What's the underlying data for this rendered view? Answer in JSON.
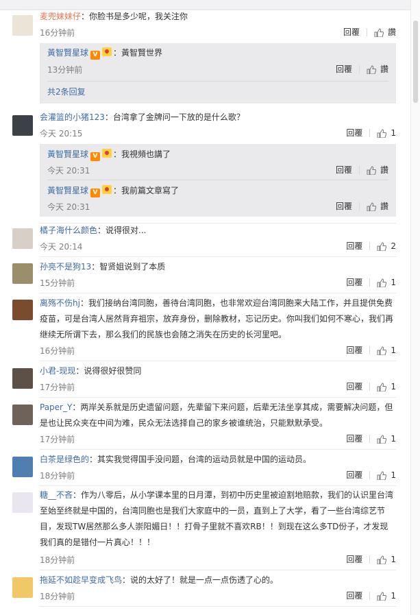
{
  "reply_label": "回覆",
  "like_label": "讚",
  "colors": {
    "username": "#eb7350",
    "link": "#3d6ca8",
    "muted": "#808080",
    "reply_bg": "#eaeaec"
  },
  "comments": [
    {
      "user": "麦兜妹妹仔",
      "text": "：你脸书是多少呢，我关注你",
      "time": "16分钟前",
      "like": "讚",
      "replies": [
        {
          "user": "黃智賢星球",
          "text": "：黃智賢世界",
          "time": "13分钟前",
          "like": "讚"
        }
      ],
      "more": "共2条回复"
    },
    {
      "user": "会灌篮的小猪123",
      "text": "：台湾拿了金牌问一下放的是什么歌？",
      "time": "今天 20:15",
      "like": "1",
      "replies": [
        {
          "user": "黃智賢星球",
          "text": "：我視頻也講了",
          "time": "今天 20:31",
          "like": "讚"
        },
        {
          "user": "黃智賢星球",
          "text": "：我前篇文章寫了",
          "time": "今天 20:31",
          "like": "讚"
        }
      ]
    },
    {
      "user": "橘子海什么颜色",
      "text": "：说得很对...",
      "time": "今天 20:14",
      "like": "2"
    },
    {
      "user": "孙亮不是狗13",
      "text": "：智贤姐说到了本质",
      "time": "15分钟前",
      "like": "1"
    },
    {
      "user": "离殇不伤hj",
      "text": "：我们接纳台湾同胞，善待台湾同胞，也非常欢迎台湾同胞来大陆工作，并且提供免费疫苗，可是台湾人居然背弃祖宗，放弃身份，删除教材，忘记历史。你叫我们如何不寒心，我们再继续无所谓下去，那么我们的民族也会随之消失在历史的长河里吧。",
      "time": "16分钟前",
      "like": "1"
    },
    {
      "user": "小君-现现",
      "text": "：说得很好很赞同",
      "time": "17分钟前",
      "like": "1"
    },
    {
      "user": "Paper_Y",
      "text": "：两岸关系就是历史遗留问题，先辈留下来问题，后辈无法坐享其成，需要解决问题，但是也让民众夹在中间为难，民众无法选择自己的家乡被谁统治，只能默默承受。",
      "time": "17分钟前",
      "like": "1"
    },
    {
      "user": "白茶是绿色的",
      "text": "：其实我觉得国手没问题，台湾的运动员就是中国的运动员。",
      "time": "18分钟前",
      "like": "1"
    },
    {
      "user": "糖__不吝",
      "text": "：作为八零后，从小学课本里的日月潭，到初中历史里被迫割地赔款，我们的认识里台湾至始至终就是中国的，台湾同胞也是我们大家庭中的一员，直到上了大学，看了一些台湾综艺节目，发现TW居然那么多人崇阳媚日！！打骨子里就不喜欢RB！！到现在这么多TD份子，才发现我们真的是错付一片真心！！！",
      "time": "18分钟前",
      "like": "1"
    },
    {
      "user": "拖延不如趁早变成飞鸟",
      "text": "：说的太好了！就是一点一点伤透了心的。",
      "time": "18分钟前",
      "like": "1"
    }
  ]
}
